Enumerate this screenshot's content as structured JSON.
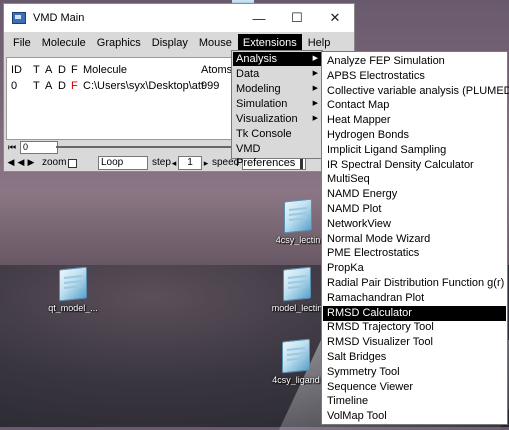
{
  "window": {
    "title": "VMD Main",
    "controls": {
      "minimize": "—",
      "maximize": "☐",
      "close": "✕"
    }
  },
  "menubar": [
    "File",
    "Molecule",
    "Graphics",
    "Display",
    "Mouse",
    "Extensions",
    "Help"
  ],
  "molecule_list": {
    "headers": {
      "id": "ID",
      "t": "T",
      "a": "A",
      "d": "D",
      "f": "F",
      "molecule": "Molecule",
      "atoms": "Atoms"
    },
    "rows": [
      {
        "id": "0",
        "t": "T",
        "a": "A",
        "d": "D",
        "f": "F",
        "molecule": "C:\\Users\\syx\\Desktop\\att",
        "atoms": "999"
      }
    ]
  },
  "animation": {
    "frame": "0",
    "zoom_label": "zoom",
    "loop_mode": "Loop",
    "step_label": "step",
    "step_value": "1",
    "speed_label": "speed"
  },
  "extensions_menu": [
    {
      "label": "Analysis",
      "has_submenu": true
    },
    {
      "label": "Data",
      "has_submenu": true
    },
    {
      "label": "Modeling",
      "has_submenu": true
    },
    {
      "label": "Simulation",
      "has_submenu": true
    },
    {
      "label": "Visualization",
      "has_submenu": true
    },
    {
      "label": "Tk Console",
      "has_submenu": false
    },
    {
      "label": "VMD Preferences",
      "has_submenu": false
    }
  ],
  "analysis_submenu": [
    "Analyze FEP Simulation",
    "APBS Electrostatics",
    "Collective variable analysis (PLUMED)",
    "Contact Map",
    "Heat Mapper",
    "Hydrogen Bonds",
    "Implicit Ligand Sampling",
    "IR Spectral Density Calculator",
    "MultiSeq",
    "NAMD Energy",
    "NAMD Plot",
    "NetworkView",
    "Normal Mode Wizard",
    "PME Electrostatics",
    "PropKa",
    "Radial Pair Distribution Function g(r)",
    "Ramachandran Plot",
    "RMSD Calculator",
    "RMSD Trajectory Tool",
    "RMSD Visualizer Tool",
    "Salt Bridges",
    "Symmetry Tool",
    "Sequence Viewer",
    "Timeline",
    "VolMap Tool"
  ],
  "desktop_icons": [
    "4csy_lectin",
    "qt_model_...",
    "model_lectin",
    "4csy_ligand"
  ],
  "colors": {
    "menu_highlight": "#000000",
    "window_bg": "#d9d9d9",
    "flag_f": "#d40000"
  }
}
